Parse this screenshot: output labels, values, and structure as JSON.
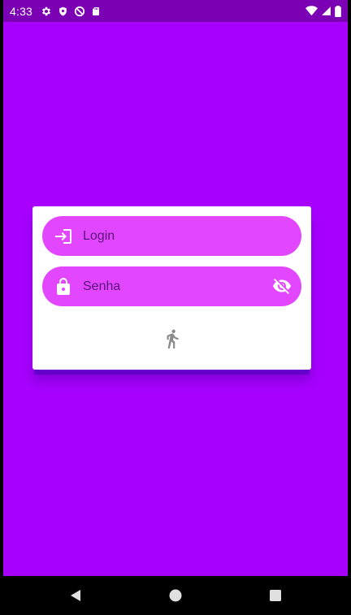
{
  "status_bar": {
    "time": "4:33",
    "left_icons": [
      "settings-icon",
      "shield-icon",
      "at-sign-icon",
      "sd-card-icon"
    ],
    "right_icons": [
      "wifi-icon",
      "signal-icon",
      "battery-icon"
    ]
  },
  "form": {
    "login_placeholder": "Login",
    "password_placeholder": "Senha"
  },
  "colors": {
    "background": "#a800ff",
    "status_bar": "#7b00b4",
    "field_fill": "#e346ff",
    "card": "#ffffff"
  },
  "nav_bar": {
    "buttons": [
      "back",
      "home",
      "recents"
    ]
  }
}
